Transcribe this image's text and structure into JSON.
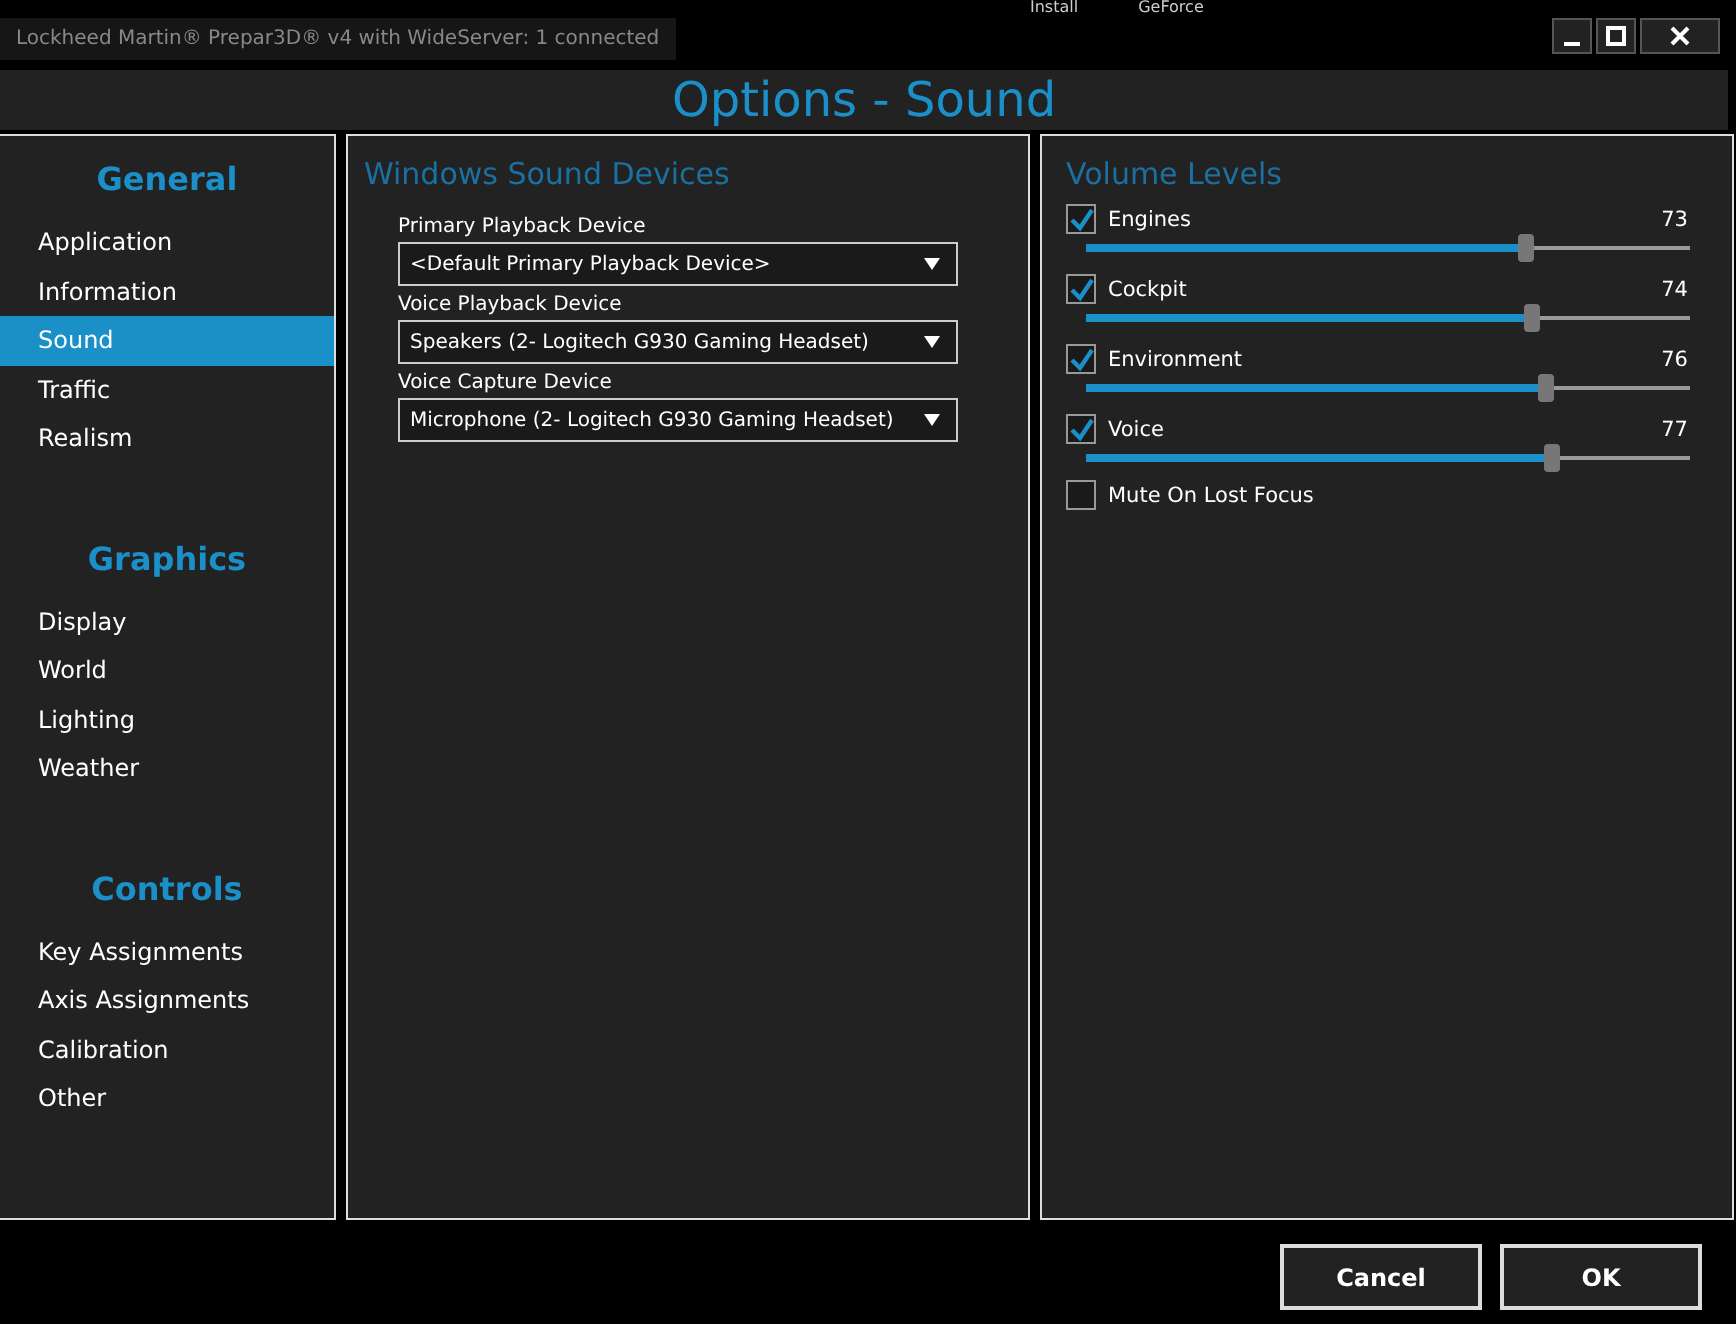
{
  "desktop": {
    "labels": [
      "Install",
      "GeForce"
    ]
  },
  "host_window": {
    "title": "Lockheed Martin® Prepar3D® v4 with WideServer: 1 connected"
  },
  "dialog": {
    "title": "Options - Sound"
  },
  "sidebar": {
    "groups": [
      {
        "heading": "General",
        "items": [
          {
            "label": "Application",
            "selected": false
          },
          {
            "label": "Information",
            "selected": false
          },
          {
            "label": "Sound",
            "selected": true
          },
          {
            "label": "Traffic",
            "selected": false
          },
          {
            "label": "Realism",
            "selected": false
          }
        ]
      },
      {
        "heading": "Graphics",
        "items": [
          {
            "label": "Display",
            "selected": false
          },
          {
            "label": "World",
            "selected": false
          },
          {
            "label": "Lighting",
            "selected": false
          },
          {
            "label": "Weather",
            "selected": false
          }
        ]
      },
      {
        "heading": "Controls",
        "items": [
          {
            "label": "Key Assignments",
            "selected": false
          },
          {
            "label": "Axis Assignments",
            "selected": false
          },
          {
            "label": "Calibration",
            "selected": false
          },
          {
            "label": "Other",
            "selected": false
          }
        ]
      }
    ]
  },
  "devices": {
    "heading": "Windows Sound Devices",
    "fields": [
      {
        "label": "Primary Playback Device",
        "value": "<Default Primary Playback Device>"
      },
      {
        "label": "Voice Playback Device",
        "value": "Speakers (2- Logitech G930 Gaming Headset)"
      },
      {
        "label": "Voice Capture Device",
        "value": "Microphone (2- Logitech G930 Gaming Headset)"
      }
    ]
  },
  "volume": {
    "heading": "Volume Levels",
    "channels": [
      {
        "name": "Engines",
        "checked": true,
        "reading": "73",
        "level": 0.73
      },
      {
        "name": "Cockpit",
        "checked": true,
        "reading": "74",
        "level": 0.74
      },
      {
        "name": "Environment",
        "checked": true,
        "reading": "76",
        "level": 0.76
      },
      {
        "name": "Voice",
        "checked": true,
        "reading": "77",
        "level": 0.77
      }
    ],
    "mute": {
      "label": "Mute On Lost Focus",
      "checked": false
    }
  },
  "buttons": [
    "Cancel",
    "OK"
  ]
}
